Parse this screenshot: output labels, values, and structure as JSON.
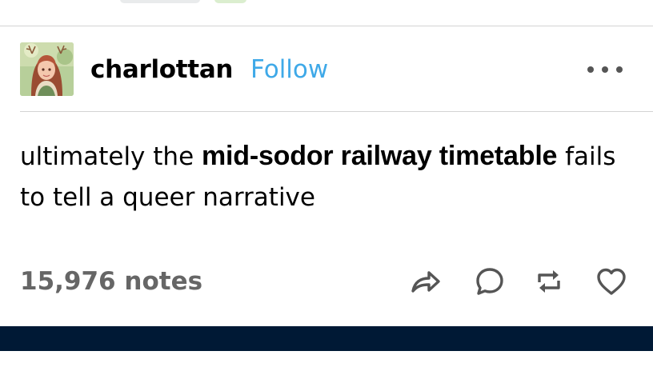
{
  "post": {
    "author": {
      "username": "charlottan",
      "follow_label": "Follow",
      "avatar_icon": "avatar-illustration"
    },
    "more_menu_icon": "more-horizontal-icon",
    "body": {
      "text_before": "ultimately the ",
      "highlight": "mid-sodor railway timetable",
      "text_after": " fails to tell a queer narrative"
    },
    "notes_label": "15,976 notes",
    "actions": [
      {
        "name": "share-icon"
      },
      {
        "name": "reply-icon"
      },
      {
        "name": "reblog-icon"
      },
      {
        "name": "like-icon"
      }
    ]
  },
  "colors": {
    "follow": "#3fa9e8",
    "notes": "#666666",
    "icons": "#555555",
    "bottom_bar": "#001935",
    "divider": "#d4d4d4"
  }
}
